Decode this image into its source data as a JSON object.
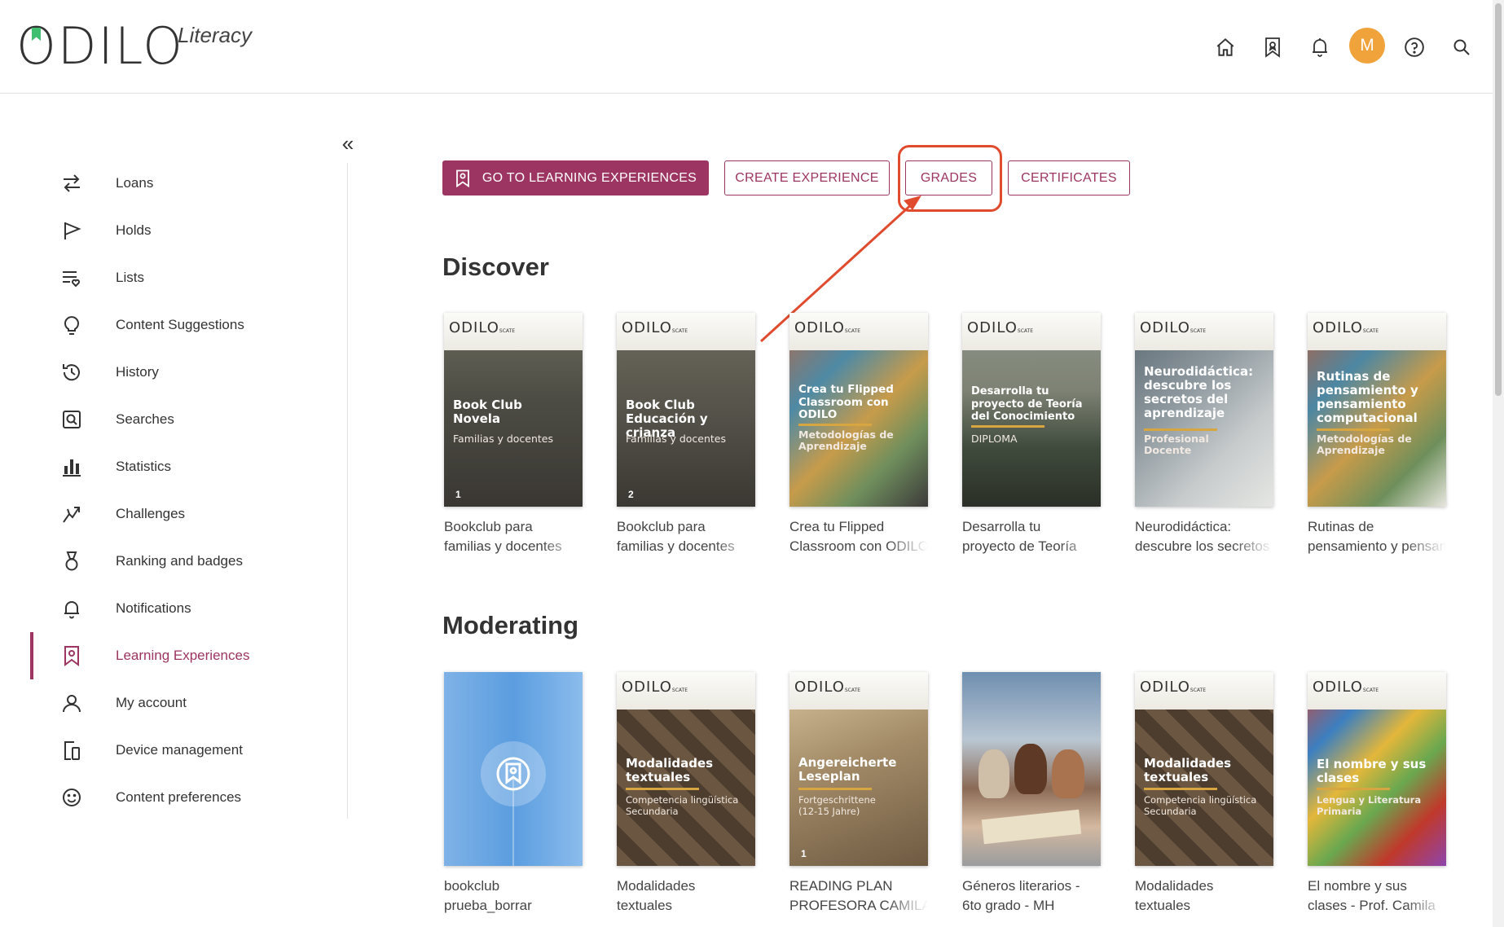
{
  "header": {
    "brand": "ODILO",
    "product": "Literacy",
    "avatar_initial": "M",
    "icons": [
      "home-icon",
      "bookmark-icon",
      "bell-icon",
      "avatar",
      "help-icon",
      "search-icon"
    ]
  },
  "sidebar": {
    "collapse_label": "«",
    "items": [
      {
        "label": "Loans",
        "icon": "swap-arrows-icon"
      },
      {
        "label": "Holds",
        "icon": "flag-icon"
      },
      {
        "label": "Lists",
        "icon": "list-heart-icon"
      },
      {
        "label": "Content Suggestions",
        "icon": "lightbulb-icon"
      },
      {
        "label": "History",
        "icon": "history-icon"
      },
      {
        "label": "Searches",
        "icon": "search-box-icon"
      },
      {
        "label": "Statistics",
        "icon": "bar-chart-icon"
      },
      {
        "label": "Challenges",
        "icon": "challenge-icon"
      },
      {
        "label": "Ranking and badges",
        "icon": "medal-icon"
      },
      {
        "label": "Notifications",
        "icon": "bell-icon"
      },
      {
        "label": "Learning Experiences",
        "icon": "learning-bookmark-icon",
        "active": true
      },
      {
        "label": "My account",
        "icon": "user-icon"
      },
      {
        "label": "Device management",
        "icon": "devices-icon"
      },
      {
        "label": "Content preferences",
        "icon": "smiley-icon"
      }
    ]
  },
  "actions": {
    "go_to": "GO TO LEARNING EXPERIENCES",
    "create": "CREATE EXPERIENCE",
    "grades": "GRADES",
    "certificates": "CERTIFICATES"
  },
  "colors": {
    "accent": "#9c3561",
    "annotation": "#e04b2e",
    "avatar": "#f0a33a"
  },
  "discover": {
    "title": "Discover",
    "cards": [
      {
        "cover_title": "Book Club\nNovela",
        "cover_sub": "Familias y docentes",
        "cover_num": "1",
        "line1": "Bookclub para",
        "line2": "familias y docentes"
      },
      {
        "cover_title": "Book Club\nEducación y crianza",
        "cover_sub": "Familias y docentes",
        "cover_num": "2",
        "line1": "Bookclub para",
        "line2": "familias y docentes"
      },
      {
        "cover_title": "Crea tu Flipped\nClassroom con\nODILO",
        "cover_sub": "Metodologías de\nAprendizaje",
        "cover_num": "",
        "line1": "Crea tu Flipped",
        "line2": "Classroom con ODILO"
      },
      {
        "cover_title": "Desarrolla tu\nproyecto de Teoría\ndel Conocimiento",
        "cover_sub": "DIPLOMA",
        "cover_num": "",
        "line1": "Desarrolla tu",
        "line2": "proyecto de Teoría"
      },
      {
        "cover_title": "Neurodidáctica:\ndescubre los\nsecretos del\naprendizaje",
        "cover_sub": "Profesional\nDocente",
        "cover_num": "",
        "line1": "Neurodidáctica:",
        "line2": "descubre los secretos"
      },
      {
        "cover_title": "Rutinas de\npensamiento y\npensamiento\ncomputacional",
        "cover_sub": "Metodologías de\nAprendizaje",
        "cover_num": "",
        "line1": "Rutinas de",
        "line2": "pensamiento y pensamiento"
      }
    ]
  },
  "moderating": {
    "title": "Moderating",
    "cards": [
      {
        "cover_title": "",
        "cover_sub": "",
        "cover_num": "",
        "line1": "bookclub",
        "line2": "prueba_borrar"
      },
      {
        "cover_title": "Modalidades\ntextuales",
        "cover_sub": "Competencia lingüística\nSecundaria",
        "cover_num": "",
        "line1": "Modalidades",
        "line2": "textuales"
      },
      {
        "cover_title": "Angereicherte\nLeseplan",
        "cover_sub": "Fortgeschrittene\n(12-15 Jahre)",
        "cover_num": "1",
        "line1": "READING PLAN",
        "line2": "PROFESORA CAMILA"
      },
      {
        "cover_title": "",
        "cover_sub": "",
        "cover_num": "",
        "line1": "Géneros literarios -",
        "line2": "6to grado - MH"
      },
      {
        "cover_title": "Modalidades\ntextuales",
        "cover_sub": "Competencia lingüística\nSecundaria",
        "cover_num": "",
        "line1": "Modalidades",
        "line2": "textuales"
      },
      {
        "cover_title": "El nombre y sus\nclases",
        "cover_sub": "Lengua y Literatura\nPrimaria",
        "cover_num": "",
        "line1": "El nombre y sus",
        "line2": "clases - Prof. Camila"
      }
    ]
  }
}
